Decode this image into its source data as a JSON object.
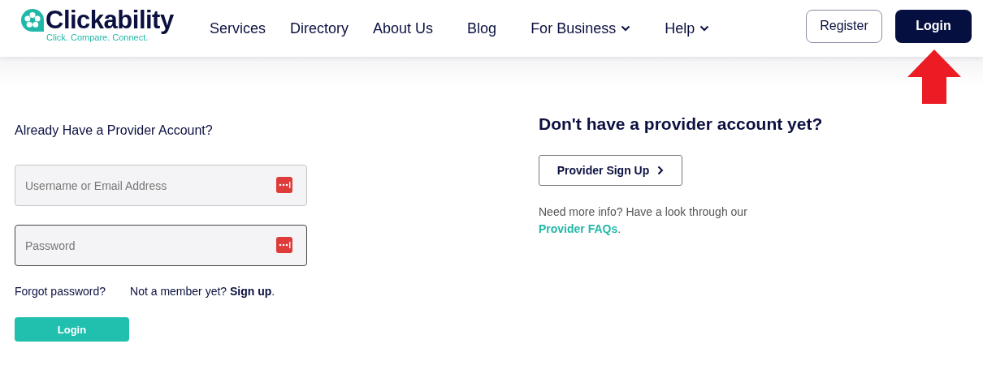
{
  "header": {
    "logo": {
      "name": "Clickability",
      "tagline": "Click. Compare. Connect."
    },
    "nav": [
      {
        "label": "Services",
        "has_menu": false
      },
      {
        "label": "Directory",
        "has_menu": false
      },
      {
        "label": "About Us",
        "has_menu": false
      },
      {
        "label": "Blog",
        "has_menu": false
      },
      {
        "label": "For Business",
        "has_menu": true
      },
      {
        "label": "Help",
        "has_menu": true
      }
    ],
    "register": "Register",
    "login": "Login"
  },
  "login_form": {
    "title": "Already Have a Provider Account?",
    "fields": [
      {
        "placeholder": "Username or Email Address",
        "focused": false
      },
      {
        "placeholder": "Password",
        "focused": true
      }
    ],
    "forgot": "Forgot password?",
    "member_prompt": "Not a member yet?",
    "signup_link": "Sign up",
    "signup_end": ".",
    "submit": "Login"
  },
  "signup": {
    "title": "Don't have a provider account yet?",
    "button": "Provider Sign Up",
    "info": "Need more info? Have a look through our",
    "faq_link": "Provider FAQs",
    "info_end": "."
  }
}
